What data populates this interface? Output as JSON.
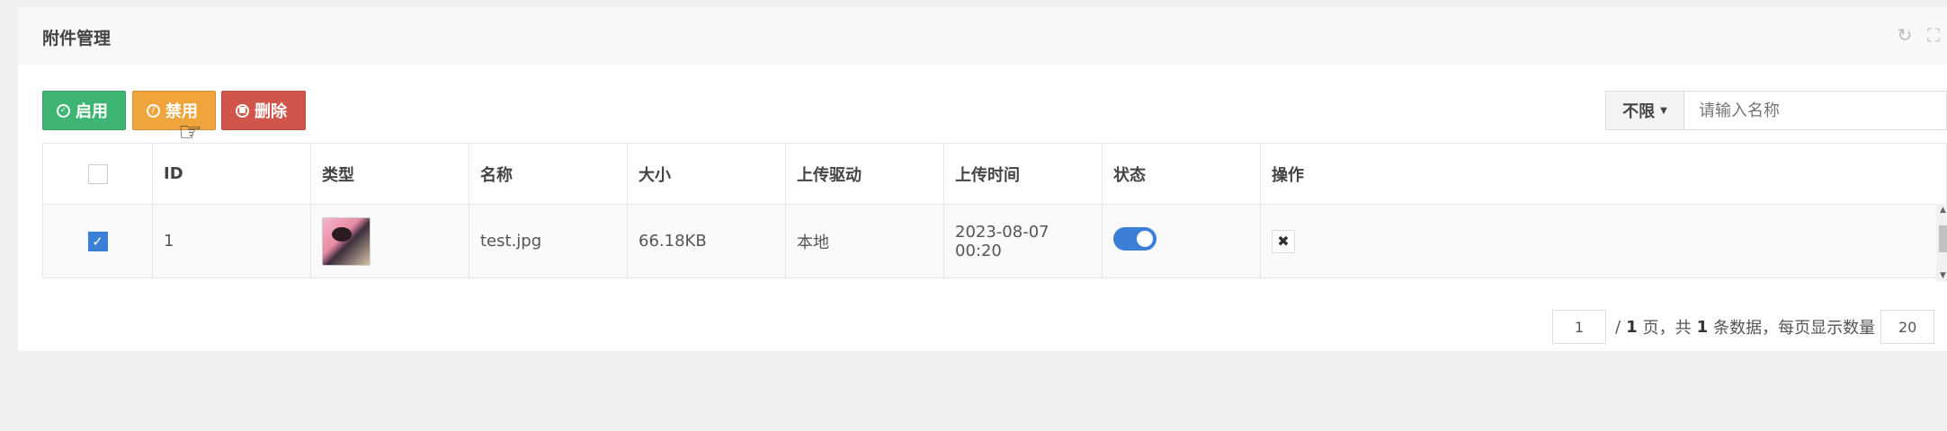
{
  "panel": {
    "title": "附件管理"
  },
  "toolbar": {
    "enable_label": "启用",
    "disable_label": "禁用",
    "delete_label": "删除"
  },
  "filter": {
    "select_value": "不限",
    "search_placeholder": "请输入名称"
  },
  "table": {
    "headers": [
      "ID",
      "类型",
      "名称",
      "大小",
      "上传驱动",
      "上传时间",
      "状态",
      "操作"
    ],
    "rows": [
      {
        "id": "1",
        "name": "test.jpg",
        "size": "66.18KB",
        "driver": "本地",
        "time": "2023-08-07 00:20",
        "status_on": true,
        "checked": true
      }
    ]
  },
  "pagination": {
    "current_page": "1",
    "sep_text": "/",
    "total_pages": "1",
    "page_unit_text": "页，共",
    "total_records": "1",
    "records_suffix_text": "条数据，每页显示数量",
    "page_size": "20"
  },
  "colors": {
    "enable": "#3fb574",
    "disable": "#f0a43c",
    "delete": "#d0564c",
    "accent": "#3b7fd6"
  }
}
